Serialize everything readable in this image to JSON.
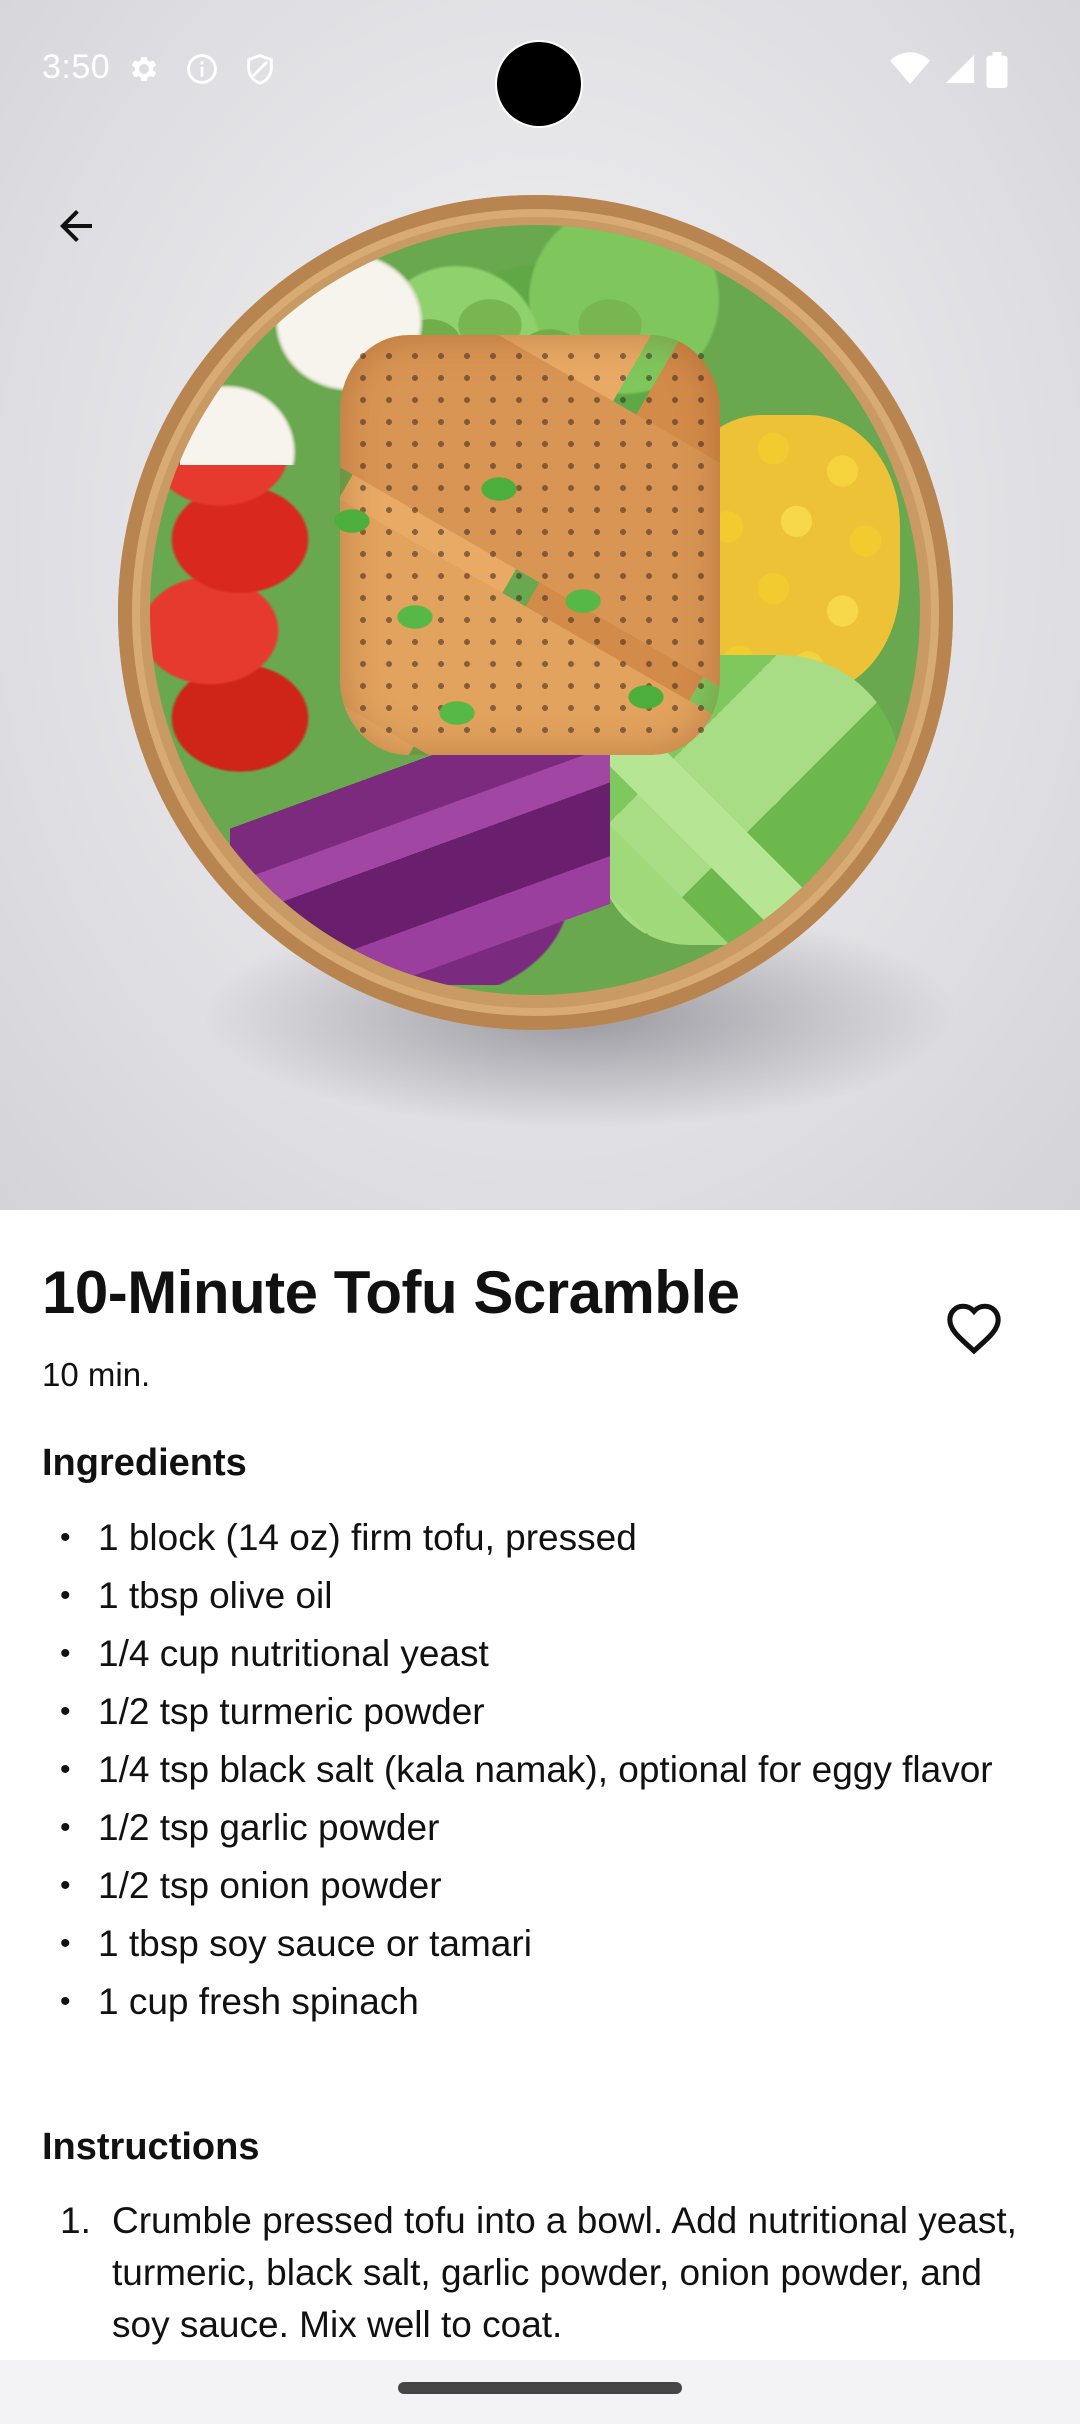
{
  "status_bar": {
    "time": "3:50",
    "left_icons": [
      "settings-icon",
      "info-icon",
      "shield-icon"
    ],
    "right_icons": [
      "wifi-icon",
      "signal-icon",
      "battery-icon"
    ]
  },
  "hero": {
    "image_name": "tofu-bowl-image"
  },
  "recipe": {
    "title": "10-Minute Tofu Scramble",
    "duration": "10 min.",
    "ingredients_heading": "Ingredients",
    "ingredients": [
      "1 block (14 oz) firm tofu, pressed",
      "1 tbsp olive oil",
      "1/4 cup nutritional yeast",
      "1/2 tsp turmeric powder",
      "1/4 tsp black salt (kala namak), optional for eggy flavor",
      "1/2 tsp garlic powder",
      "1/2 tsp onion powder",
      "1 tbsp soy sauce or tamari",
      "1 cup fresh spinach"
    ],
    "instructions_heading": "Instructions",
    "instructions": [
      {
        "number": "1.",
        "text": "Crumble pressed tofu into a bowl. Add nutritional yeast, turmeric, black salt, garlic powder, onion powder, and soy sauce. Mix well to coat."
      }
    ]
  },
  "colors": {
    "text": "#111111",
    "background": "#ffffff",
    "nav_bar": "#f3f3f5"
  }
}
